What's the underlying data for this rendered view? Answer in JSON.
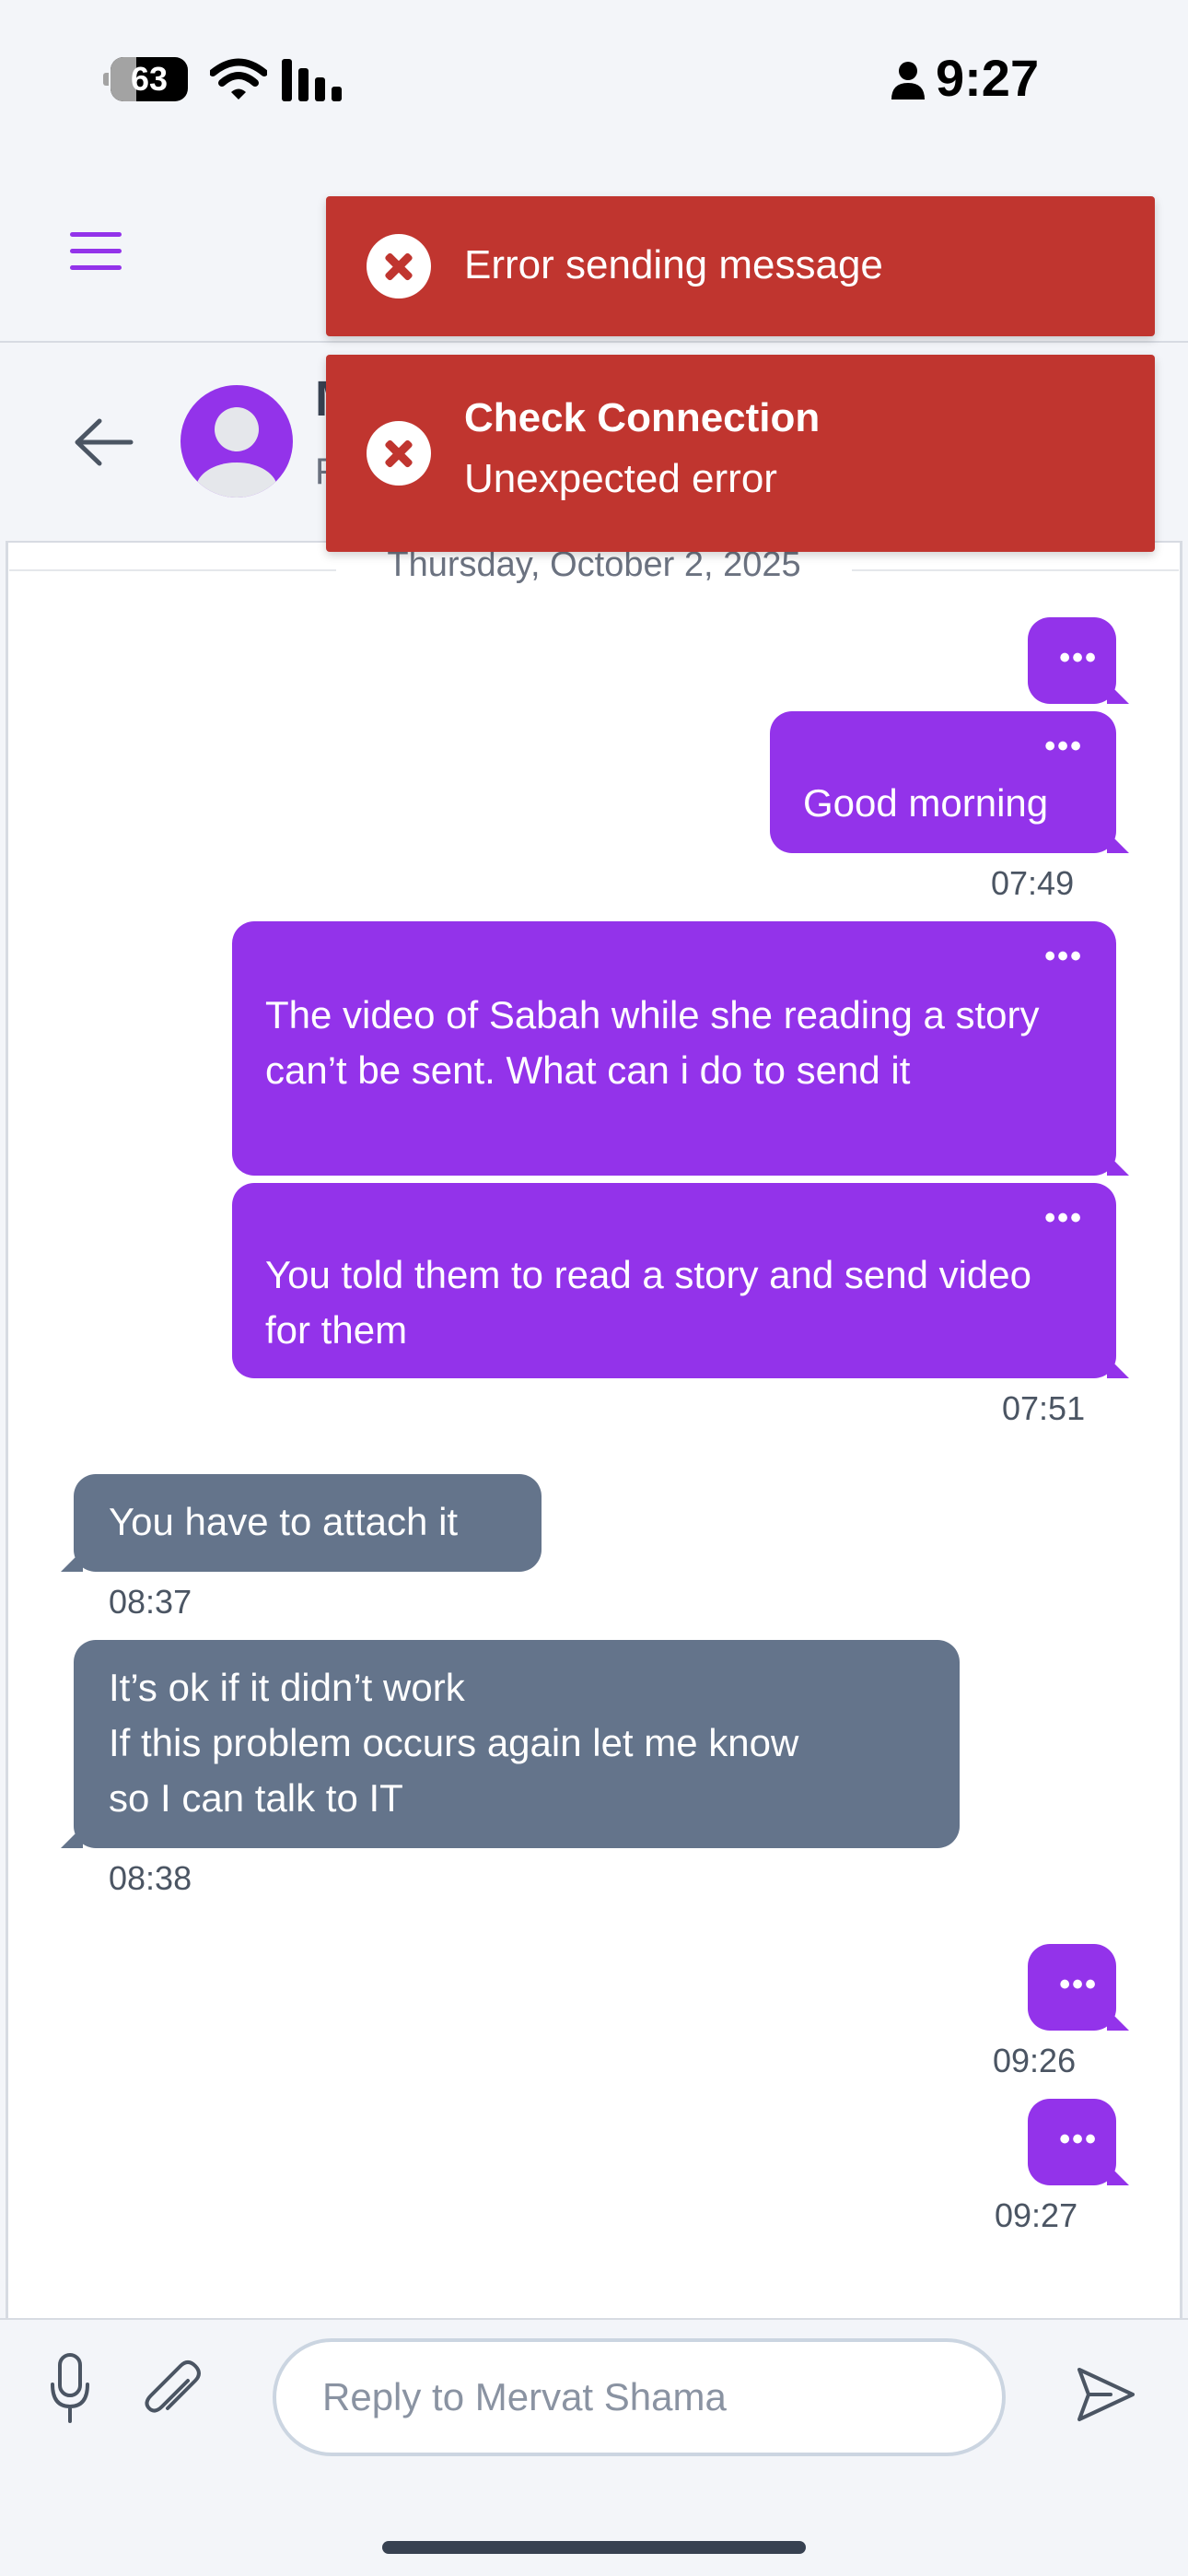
{
  "status_bar": {
    "battery_level": "63",
    "time": "9:27"
  },
  "header": {
    "menu_icon": "hamburger-icon"
  },
  "chat_header": {
    "back_icon": "arrow-left-icon",
    "contact_name_visible": "M",
    "contact_subtitle_visible": "F"
  },
  "toasts": [
    {
      "title": "Error sending message",
      "message": ""
    },
    {
      "title": "Check Connection",
      "message": "Unexpected error"
    }
  ],
  "date_divider": "Thursday, October 2, 2025",
  "messages": [
    {
      "direction": "out",
      "text": "",
      "time": ""
    },
    {
      "direction": "out",
      "text": "Good morning",
      "time": "07:49"
    },
    {
      "direction": "out",
      "text": "The video of Sabah while she reading a story can’t be sent. What can i do to send it",
      "time": ""
    },
    {
      "direction": "out",
      "text": "You told them to read a story and send video for them",
      "time": "07:51"
    },
    {
      "direction": "in",
      "text": "You have to attach it",
      "time": "08:37"
    },
    {
      "direction": "in",
      "lines": [
        "It’s ok if it didn’t work",
        "If this problem occurs again let me know",
        "so I can talk to IT"
      ],
      "time": "08:38"
    },
    {
      "direction": "out",
      "text": "",
      "time": "09:26"
    },
    {
      "direction": "out",
      "text": "",
      "time": "09:27"
    }
  ],
  "message_options_label": "•••",
  "input": {
    "placeholder": "Reply to Mervat Shama"
  },
  "colors": {
    "accent": "#9333ea",
    "incoming": "#64748b",
    "error": "#c0352f"
  }
}
